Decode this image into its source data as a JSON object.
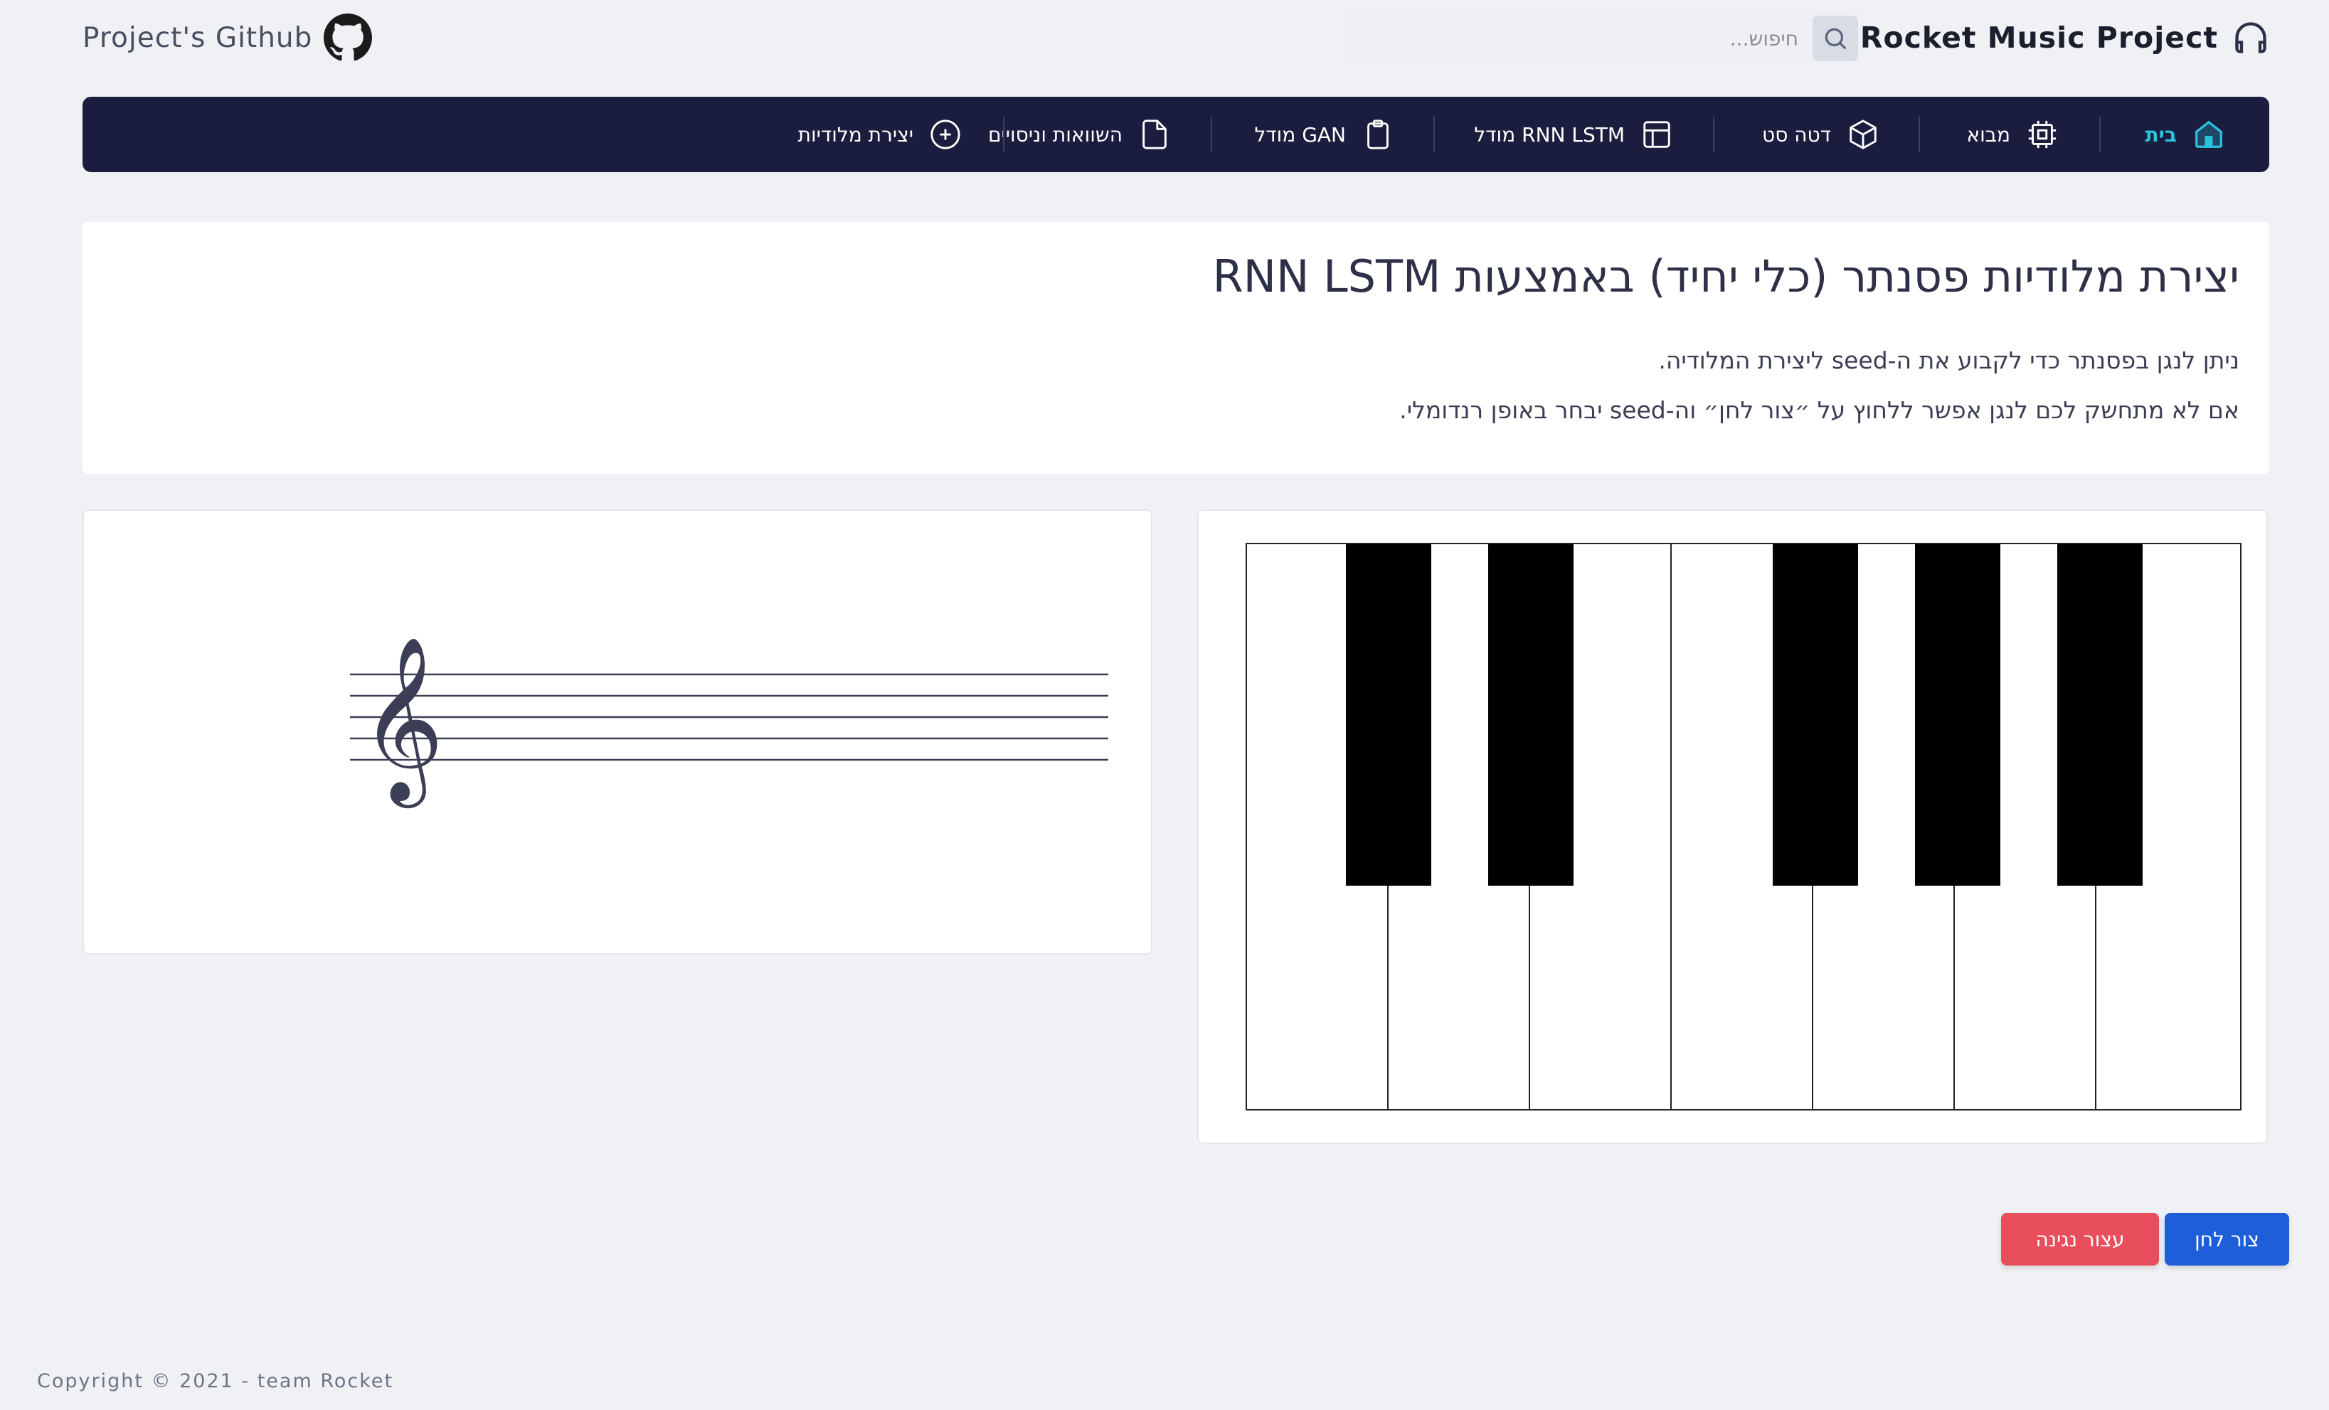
{
  "header": {
    "github_label": "Project's Github",
    "brand_title": "Rocket Music Project",
    "search_placeholder": "חיפוש..."
  },
  "nav": {
    "items": [
      {
        "label": "בית",
        "icon": "home-icon",
        "active": true
      },
      {
        "label": "מבוא",
        "icon": "chip-icon"
      },
      {
        "label": "דטה סט",
        "icon": "cube-icon"
      },
      {
        "label": "מודל RNN LSTM",
        "icon": "layout-icon"
      },
      {
        "label": "מודל GAN",
        "icon": "clipboard-icon"
      },
      {
        "label": "השוואות וניסויים",
        "icon": "file-icon"
      },
      {
        "label": "יצירת מלודיות",
        "icon": "plus-circle-icon"
      }
    ]
  },
  "intro": {
    "title": "יצירת מלודיות פסנתר (כלי יחיד) באמצעות RNN LSTM",
    "line1": "ניתן לנגן בפסנתר כדי לקבוע את ה-seed ליצירת המלודיה.",
    "line2": "אם לא מתחשק לכם לנגן אפשר ללחוץ על ״צור לחן״ וה-seed יבחר באופן רנדומלי."
  },
  "sheet": {
    "clef": "𝄞"
  },
  "piano": {
    "white_keys": 7,
    "black_keys": 5
  },
  "buttons": {
    "play_label": "צור לחן",
    "stop_label": "עצור נגינה"
  },
  "colors": {
    "nav_bg": "#1b1d3e",
    "nav_active": "#29c3dc",
    "play_btn": "#1e5ed8",
    "stop_btn": "#e84e5c"
  },
  "footer": {
    "copyright": "Copyright © 2021 - team Rocket"
  }
}
